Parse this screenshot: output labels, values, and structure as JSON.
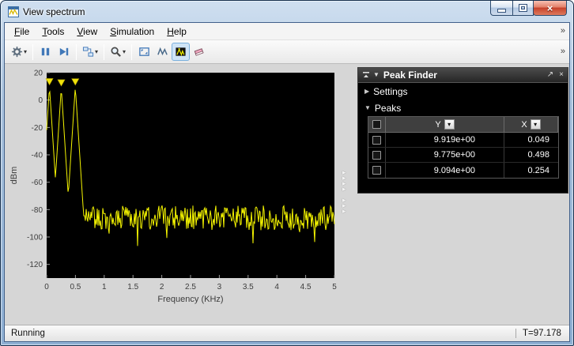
{
  "window": {
    "title": "View spectrum"
  },
  "menubar": {
    "items": [
      "File",
      "Tools",
      "View",
      "Simulation",
      "Help"
    ]
  },
  "toolbar": {
    "buttons": [
      {
        "name": "settings",
        "icon": "gear-icon",
        "dropdown": true
      },
      {
        "name": "pause",
        "icon": "pause-icon"
      },
      {
        "name": "step-forward",
        "icon": "step-forward-icon"
      },
      {
        "name": "simulink-model",
        "icon": "simulink-blocks-icon",
        "dropdown": true
      },
      {
        "name": "zoom",
        "icon": "magnifier-icon",
        "dropdown": true
      },
      {
        "name": "fit-to-view",
        "icon": "fit-to-view-icon"
      },
      {
        "name": "autoscale-y",
        "icon": "autoscale-icon"
      },
      {
        "name": "peak-finder",
        "icon": "peaks-icon",
        "pressed": true
      },
      {
        "name": "spectral-mask",
        "icon": "mask-icon"
      }
    ]
  },
  "icons": {
    "dropdown_glyph": "▾",
    "overflow_glyph": "»",
    "close_glyph": "×",
    "section_collapsed_glyph": "▶",
    "section_expanded_glyph": "▼",
    "undock_glyph": "↗",
    "panel_collapse_glyph": "▼",
    "filter_glyph": "▾",
    "splitter_glyph": "▸"
  },
  "peak_finder": {
    "title": "Peak Finder",
    "settings_label": "Settings",
    "peaks_label": "Peaks",
    "columns": [
      {
        "label": "Y"
      },
      {
        "label": "X"
      }
    ],
    "rows": [
      {
        "y": "9.919e+00",
        "x": "0.049"
      },
      {
        "y": "9.775e+00",
        "x": "0.498"
      },
      {
        "y": "9.094e+00",
        "x": "0.254"
      }
    ]
  },
  "statusbar": {
    "running_label": "Running",
    "time_label": "T=97.178"
  },
  "chart_data": {
    "type": "line",
    "title": "",
    "xlabel": "Frequency (KHz)",
    "ylabel": "dBm",
    "xlim": [
      0,
      5
    ],
    "ylim": [
      -130,
      20
    ],
    "xticks": [
      0,
      0.5,
      1,
      1.5,
      2,
      2.5,
      3,
      3.5,
      4,
      4.5,
      5
    ],
    "yticks": [
      20,
      0,
      -20,
      -40,
      -60,
      -80,
      -100,
      -120
    ],
    "grid": false,
    "legend": "none",
    "background": "#000000",
    "line_color": "#f5f500",
    "noise_floor_dbm": -86,
    "noise_amplitude_db": 9,
    "skirt_slope_db_per_khz": 650,
    "peaks": [
      {
        "x": 0.049,
        "y": 9.919
      },
      {
        "x": 0.254,
        "y": 9.094
      },
      {
        "x": 0.498,
        "y": 9.775
      }
    ]
  }
}
